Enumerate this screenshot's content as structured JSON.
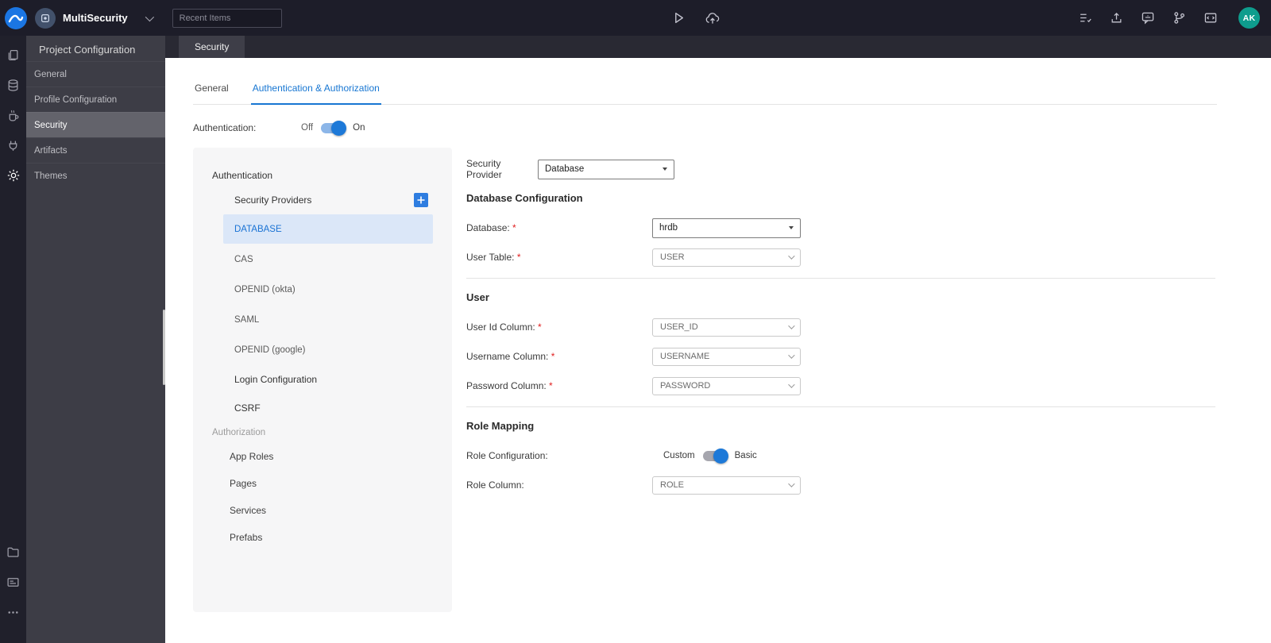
{
  "topbar": {
    "project_name": "MultiSecurity",
    "search_placeholder": "Recent Items",
    "avatar_initials": "AK",
    "center_icons": [
      "run-icon",
      "deploy-icon"
    ],
    "right_icons": [
      "checklist-icon",
      "export-icon",
      "translate-icon",
      "version-control-icon",
      "markup-icon"
    ]
  },
  "rail": {
    "top_icons": [
      "files-icon",
      "database-icon",
      "java-icon",
      "apis-icon",
      "settings-icon"
    ],
    "bottom_icons": [
      "folder-icon",
      "console-icon",
      "more-icon"
    ],
    "active_icon": "settings-icon"
  },
  "sidebar": {
    "title": "Project Configuration",
    "items": [
      {
        "label": "General",
        "active": false
      },
      {
        "label": "Profile Configuration",
        "active": false
      },
      {
        "label": "Security",
        "active": true
      },
      {
        "label": "Artifacts",
        "active": false
      },
      {
        "label": "Themes",
        "active": false
      }
    ]
  },
  "tabstrip": {
    "active_tab": "Security"
  },
  "subtabs": [
    {
      "label": "General",
      "active": false
    },
    {
      "label": "Authentication & Authorization",
      "active": true
    }
  ],
  "auth": {
    "label": "Authentication:",
    "off_label": "Off",
    "on_label": "On",
    "state": "on"
  },
  "nav_panel": {
    "items": [
      {
        "label": "Authentication",
        "type": "heading"
      },
      {
        "label": "Security Providers",
        "type": "item",
        "add_button": true
      },
      {
        "label": "DATABASE",
        "type": "provider",
        "selected": true
      },
      {
        "label": "CAS",
        "type": "provider",
        "selected": false
      },
      {
        "label": "OPENID (okta)",
        "type": "provider",
        "selected": false
      },
      {
        "label": "SAML",
        "type": "provider",
        "selected": false
      },
      {
        "label": "OPENID (google)",
        "type": "provider",
        "selected": false
      },
      {
        "label": "Login Configuration",
        "type": "item"
      },
      {
        "label": "CSRF",
        "type": "item"
      },
      {
        "label": "Authorization",
        "type": "heading-muted"
      },
      {
        "label": "App Roles",
        "type": "item2"
      },
      {
        "label": "Pages",
        "type": "item2"
      },
      {
        "label": "Services",
        "type": "item2"
      },
      {
        "label": "Prefabs",
        "type": "item2"
      }
    ]
  },
  "form": {
    "provider_label": "Security Provider",
    "provider_value": "Database",
    "sections": [
      {
        "title": "Database Configuration",
        "rows": [
          {
            "label": "Database:",
            "required": true,
            "control": "native-select",
            "value": "hrdb"
          },
          {
            "label": "User Table:",
            "required": true,
            "control": "select",
            "value": "USER"
          }
        ]
      },
      {
        "title": "User",
        "rows": [
          {
            "label": "User Id Column:",
            "required": true,
            "control": "select",
            "value": "USER_ID"
          },
          {
            "label": "Username Column:",
            "required": true,
            "control": "select",
            "value": "USERNAME"
          },
          {
            "label": "Password Column:",
            "required": true,
            "control": "select",
            "value": "PASSWORD"
          }
        ]
      },
      {
        "title": "Role Mapping",
        "rows": [
          {
            "label": "Role Configuration:",
            "required": false,
            "control": "toggle",
            "left": "Custom",
            "right": "Basic",
            "state": "right"
          },
          {
            "label": "Role Column:",
            "required": false,
            "control": "select",
            "value": "ROLE"
          }
        ]
      }
    ]
  },
  "colors": {
    "accent": "#1776d2",
    "topbar_bg": "#1d1d29",
    "sidebar_bg": "#3d3d46",
    "selected_provider_bg": "#dbe7f8",
    "avatar_bg": "#0e9d8d",
    "required": "#e02020",
    "toggle_thumb": "#1d79d8"
  }
}
